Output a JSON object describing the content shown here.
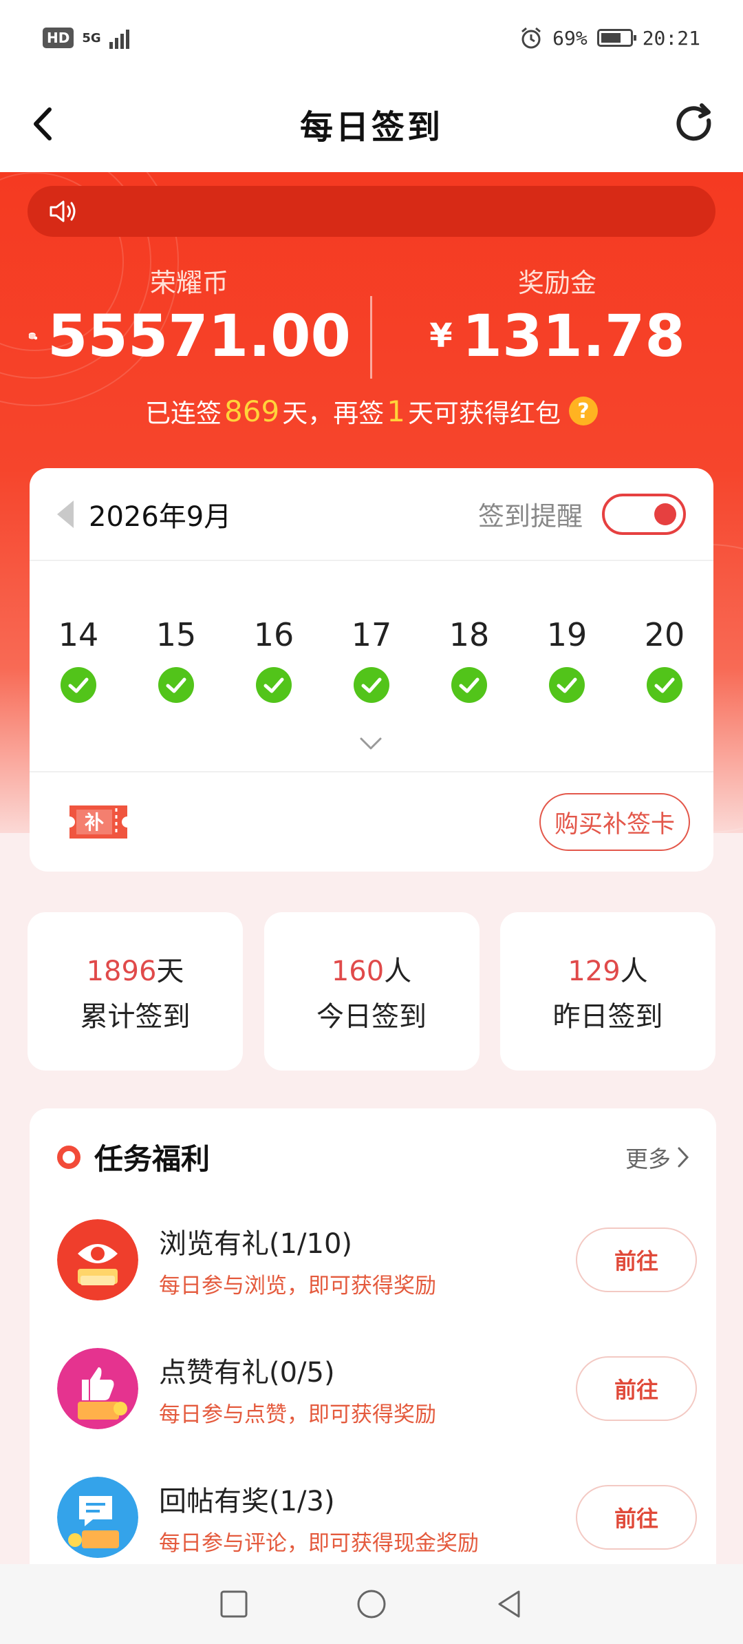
{
  "status_bar": {
    "hd": "HD",
    "net": "5G",
    "battery": "69%",
    "time": "20:21"
  },
  "nav": {
    "title": "每日签到",
    "back_icon": "back-arrow-icon",
    "refresh_icon": "refresh-icon"
  },
  "balances": {
    "coins_label": "荣耀币",
    "coins_value": "55571.00",
    "reward_label": "奖励金",
    "currency": "¥",
    "reward_value": "131.78"
  },
  "streak": {
    "prefix": "已连签",
    "days": "869",
    "middle": "天，再签",
    "remaining": "1",
    "suffix": "天可获得红包"
  },
  "calendar": {
    "month": "2026年9月",
    "remind_label": "签到提醒",
    "remind_on": true,
    "days": [
      "14",
      "15",
      "16",
      "17",
      "18",
      "19",
      "20"
    ],
    "signed": [
      true,
      true,
      true,
      true,
      true,
      true,
      true
    ],
    "makeup_card_label": "补",
    "buy_button": "购买补签卡"
  },
  "stats": [
    {
      "num": "1896",
      "unit": "天",
      "label": "累计签到"
    },
    {
      "num": "160",
      "unit": "人",
      "label": "今日签到"
    },
    {
      "num": "129",
      "unit": "人",
      "label": "昨日签到"
    }
  ],
  "tasks": {
    "title": "任务福利",
    "more": "更多",
    "items": [
      {
        "title": "浏览有礼(1/10)",
        "desc": "每日参与浏览，即可获得奖励",
        "button": "前往"
      },
      {
        "title": "点赞有礼(0/5)",
        "desc": "每日参与点赞，即可获得奖励",
        "button": "前往"
      },
      {
        "title": "回帖有奖(1/3)",
        "desc": "每日参与评论，即可获得现金奖励",
        "button": "前往"
      }
    ]
  },
  "colors": {
    "accent": "#f53a21",
    "highlight": "#ffd43b",
    "success": "#52c41a"
  }
}
